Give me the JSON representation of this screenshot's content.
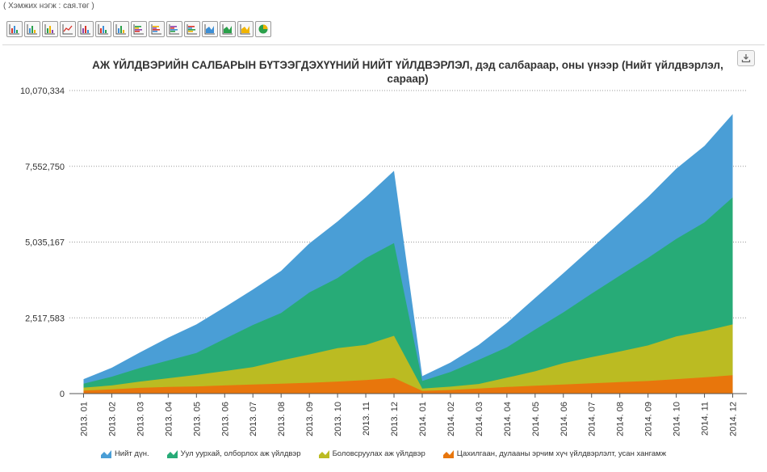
{
  "unit_note": "( Хэмжих нэгж : сая.төг )",
  "toolbar": {
    "buttons": [
      "bar-chart-icon",
      "bar-chart-icon",
      "bar-chart-icon",
      "line-chart-icon",
      "bar-chart-icon",
      "bar-chart-icon",
      "bar-chart-icon",
      "hbar-chart-icon",
      "hbar-chart-icon",
      "hbar-chart-icon",
      "hbar-chart-icon",
      "area-chart-icon",
      "area-chart-icon",
      "area-chart-icon",
      "pie-chart-icon"
    ]
  },
  "colors": {
    "total": "#4a9ed6",
    "mining": "#27ab77",
    "manufacturing": "#bbbb22",
    "electricity": "#e8760c"
  },
  "chart_data": {
    "type": "area",
    "title": "АЖ ҮЙЛДВЭРИЙН САЛБАРЫН БҮТЭЭГДЭХҮҮНИЙ НИЙТ ҮЙЛДВЭРЛЭЛ, дэд салбараар, оны үнээр (Нийт үйлдвэрлэл, сараар)",
    "y_ticks": [
      "10,070,334",
      "7,552,750",
      "5,035,167",
      "2,517,583",
      "0"
    ],
    "ylim": [
      0,
      10070334
    ],
    "grid": true,
    "legend_position": "bottom",
    "categories": [
      "2013. 01",
      "2013. 02",
      "2013. 03",
      "2013. 04",
      "2013. 05",
      "2013. 06",
      "2013. 07",
      "2013. 08",
      "2013. 09",
      "2013. 10",
      "2013. 11",
      "2013. 12",
      "2014. 01",
      "2014. 02",
      "2014. 03",
      "2014. 04",
      "2014. 05",
      "2014. 06",
      "2014. 07",
      "2014. 08",
      "2014. 09",
      "2014. 10",
      "2014. 11",
      "2014. 12"
    ],
    "series": [
      {
        "name": "Нийт дүн.",
        "key": "total",
        "values": [
          480000,
          860000,
          1370000,
          1860000,
          2300000,
          2870000,
          3460000,
          4080000,
          4990000,
          5720000,
          6530000,
          7400000,
          580000,
          1030000,
          1620000,
          2350000,
          3180000,
          4000000,
          4840000,
          5680000,
          6530000,
          7470000,
          8230000,
          9290000
        ]
      },
      {
        "name": "Уул уурхай, олборлох аж үйлдвэр",
        "key": "mining",
        "values": [
          330000,
          560000,
          850000,
          1100000,
          1350000,
          1820000,
          2280000,
          2680000,
          3360000,
          3840000,
          4500000,
          5000000,
          420000,
          720000,
          1120000,
          1540000,
          2130000,
          2700000,
          3320000,
          3920000,
          4510000,
          5140000,
          5690000,
          6520000
        ]
      },
      {
        "name": "Боловсруулах аж үйлдвэр",
        "key": "manufacturing",
        "values": [
          200000,
          270000,
          400000,
          510000,
          620000,
          750000,
          880000,
          1100000,
          1300000,
          1510000,
          1620000,
          1920000,
          170000,
          230000,
          320000,
          530000,
          740000,
          1010000,
          1210000,
          1400000,
          1600000,
          1900000,
          2080000,
          2300000
        ]
      },
      {
        "name": "Цахилгаан, дулааны эрчим хүч үйлдвэрлэлт, усан хангамж",
        "key": "electricity",
        "values": [
          100000,
          140000,
          190000,
          220000,
          240000,
          270000,
          300000,
          330000,
          360000,
          400000,
          450000,
          520000,
          90000,
          120000,
          170000,
          220000,
          260000,
          300000,
          340000,
          380000,
          420000,
          480000,
          540000,
          610000
        ]
      }
    ]
  }
}
